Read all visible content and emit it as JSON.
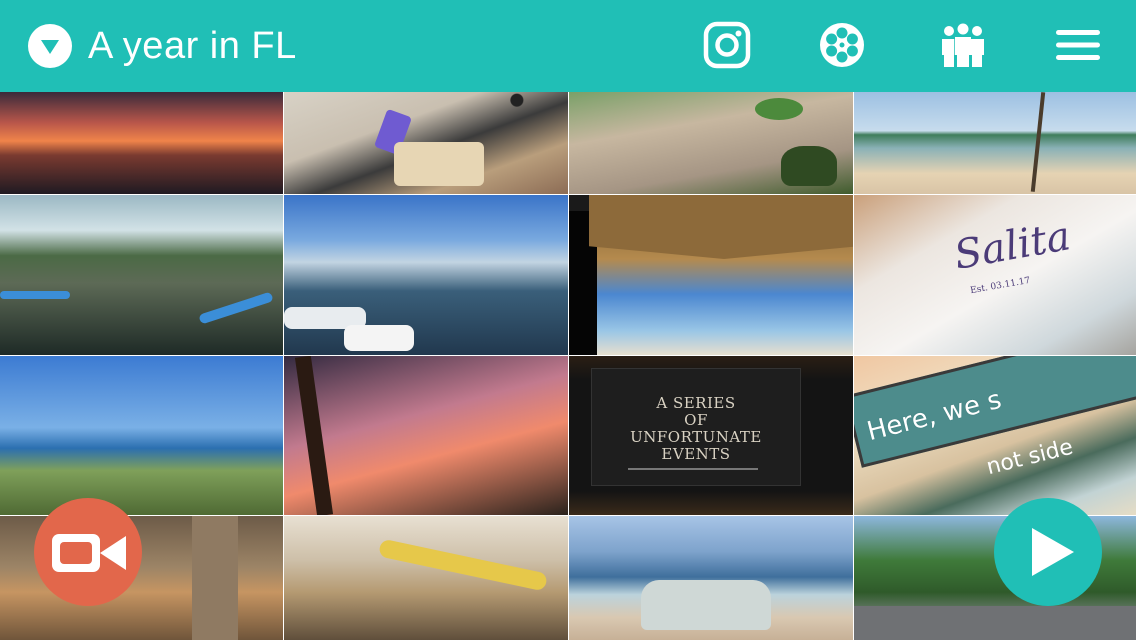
{
  "header": {
    "title": "A year in FL",
    "icons": [
      "dropdown-icon",
      "instagram-icon",
      "film-reel-icon",
      "people-icon",
      "menu-icon"
    ]
  },
  "grid": {
    "tiles": [
      {
        "name": "sunset-over-bay"
      },
      {
        "name": "baking-cookies"
      },
      {
        "name": "potted-plants"
      },
      {
        "name": "beach-with-palms"
      },
      {
        "name": "paddleboarding"
      },
      {
        "name": "marina-boats"
      },
      {
        "name": "tiki-hut"
      },
      {
        "name": "wedding-card"
      },
      {
        "name": "grassy-beach-dunes"
      },
      {
        "name": "palm-trees-dusk"
      },
      {
        "name": "tv-screen"
      },
      {
        "name": "painted-sign"
      },
      {
        "name": "tiger-enclosure"
      },
      {
        "name": "holding-snake"
      },
      {
        "name": "friends-on-beach"
      },
      {
        "name": "street-palms"
      }
    ],
    "movie_title_lines": [
      "A SERIES",
      "OF",
      "UNFORTUNATE",
      "EVENTS"
    ],
    "card_script": "Salita",
    "card_est": "Est. 03.11.17",
    "sign_text": "Here, we s",
    "sign_sub": "not side"
  },
  "buttons": {
    "record": "camera-icon",
    "play": "play-icon"
  },
  "colors": {
    "header": "#20bfb6",
    "record": "#e2674b",
    "play": "#20bfb6"
  }
}
